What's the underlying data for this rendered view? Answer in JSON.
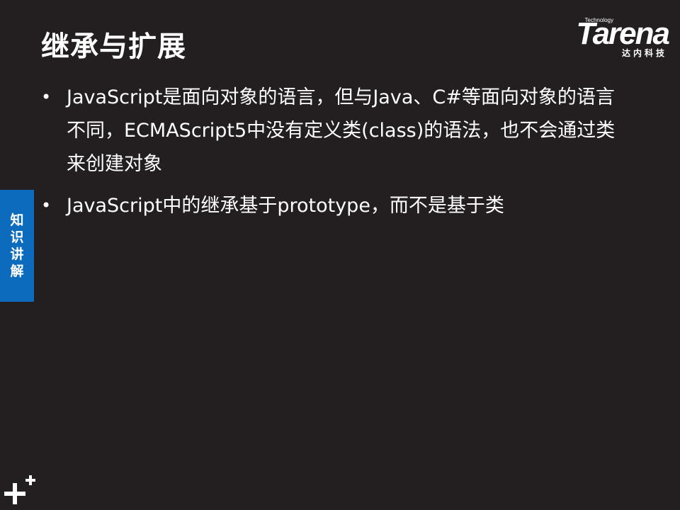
{
  "slide": {
    "title": "继承与扩展",
    "bullets": [
      "JavaScript是面向对象的语言，但与Java、C#等面向对象的语言不同，ECMAScript5中没有定义类(class)的语法，也不会通过类来创建对象",
      "JavaScript中的继承基于prototype，而不是基于类"
    ],
    "bullet_marker": "•"
  },
  "logo": {
    "technology": "Technology",
    "wordmark": "Tarena",
    "chinese": "达内科技"
  },
  "side_tab": {
    "chars": [
      "知",
      "识",
      "讲",
      "解"
    ],
    "color": "#0d6bbd"
  },
  "corner_icon": "plus-plus-icon",
  "colors": {
    "background": "#231f20",
    "text": "#ffffff",
    "accent": "#0d6bbd"
  }
}
